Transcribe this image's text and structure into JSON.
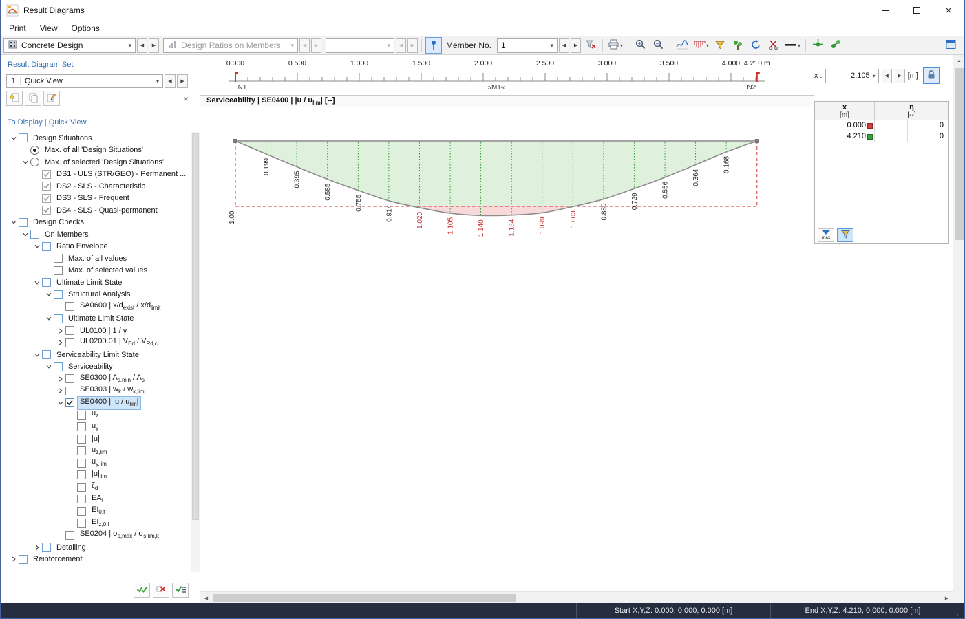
{
  "window": {
    "title": "Result Diagrams"
  },
  "menu": {
    "items": [
      {
        "label": "Print"
      },
      {
        "label": "View"
      },
      {
        "label": "Options"
      }
    ]
  },
  "toolbar": {
    "design_type": "Concrete Design",
    "result_type": "Design Ratios on Members",
    "extra_combo": "",
    "member_no_label": "Member No.",
    "member_no_value": "1",
    "icons": [
      "concrete-design-icon",
      "design-ratios-icon",
      "pin-icon",
      "funnel-x-icon",
      "printer-icon",
      "zoom-in-icon",
      "zoom-out-icon",
      "smooth-results-icon",
      "result-values-icon",
      "funnel-icon",
      "objects-icon",
      "refresh-icon",
      "trim-icon",
      "line-style-icon",
      "member-results-icon",
      "member-values-icon",
      "dock-panel-icon"
    ]
  },
  "left_panel": {
    "header": "Result Diagram Set",
    "set_number": "1",
    "set_name": "Quick View",
    "tree_header": "To Display | Quick View",
    "tree": [
      {
        "l": 0,
        "e": "down",
        "c": "cb",
        "s": "group",
        "t": "Design Situations"
      },
      {
        "l": 1,
        "e": null,
        "c": "radio",
        "s": "on",
        "t": "Max. of all 'Design Situations'"
      },
      {
        "l": 1,
        "e": "down",
        "c": "radio",
        "s": "off",
        "t": "Max. of selected 'Design Situations'"
      },
      {
        "l": 2,
        "e": null,
        "c": "cb",
        "s": "gray",
        "t": "DS1 - ULS (STR/GEO) - Permanent ..."
      },
      {
        "l": 2,
        "e": null,
        "c": "cb",
        "s": "gray",
        "t": "DS2 - SLS - Characteristic"
      },
      {
        "l": 2,
        "e": null,
        "c": "cb",
        "s": "gray",
        "t": "DS3 - SLS - Frequent"
      },
      {
        "l": 2,
        "e": null,
        "c": "cb",
        "s": "gray",
        "t": "DS4 - SLS - Quasi-permanent"
      },
      {
        "l": 0,
        "e": "down",
        "c": "cb",
        "s": "group",
        "t": "Design Checks"
      },
      {
        "l": 1,
        "e": "down",
        "c": "cb",
        "s": "group",
        "t": "On Members"
      },
      {
        "l": 2,
        "e": "down",
        "c": "cb",
        "s": "group",
        "t": "Ratio Envelope"
      },
      {
        "l": 3,
        "e": null,
        "c": "cb",
        "s": "off",
        "t": "Max. of all values"
      },
      {
        "l": 3,
        "e": null,
        "c": "cb",
        "s": "off",
        "t": "Max. of selected values"
      },
      {
        "l": 2,
        "e": "down",
        "c": "cb",
        "s": "group",
        "t": "Ultimate Limit State"
      },
      {
        "l": 3,
        "e": "down",
        "c": "cb",
        "s": "group",
        "t": "Structural Analysis"
      },
      {
        "l": 4,
        "e": null,
        "c": "cb",
        "s": "off",
        "t": "SA0600 | x/d<sub>exist</sub> / x/d<sub>limit</sub>"
      },
      {
        "l": 3,
        "e": "down",
        "c": "cb",
        "s": "group",
        "t": "Ultimate Limit State"
      },
      {
        "l": 4,
        "e": "right",
        "c": "cb",
        "s": "off",
        "t": "UL0100 | 1 / γ"
      },
      {
        "l": 4,
        "e": "right",
        "c": "cb",
        "s": "off",
        "t": "UL0200.01 | V<sub>Ed</sub> / V<sub>Rd,c</sub>"
      },
      {
        "l": 2,
        "e": "down",
        "c": "cb",
        "s": "group",
        "t": "Serviceability Limit State"
      },
      {
        "l": 3,
        "e": "down",
        "c": "cb",
        "s": "group",
        "t": "Serviceability"
      },
      {
        "l": 4,
        "e": "right",
        "c": "cb",
        "s": "off",
        "t": "SE0300 | A<sub>s,min</sub> / A<sub>s</sub>"
      },
      {
        "l": 4,
        "e": "right",
        "c": "cb",
        "s": "off",
        "t": "SE0303 | w<sub>k</sub> / w<sub>k,lim</sub>"
      },
      {
        "l": 4,
        "e": "down",
        "c": "cb",
        "s": "on",
        "sel": true,
        "t": "SE0400 | |u / u<sub>lim</sub>|"
      },
      {
        "l": 5,
        "e": null,
        "c": "cb",
        "s": "off",
        "t": "u<sub>z</sub>"
      },
      {
        "l": 5,
        "e": null,
        "c": "cb",
        "s": "off",
        "t": "u<sub>y</sub>"
      },
      {
        "l": 5,
        "e": null,
        "c": "cb",
        "s": "off",
        "t": "|u|"
      },
      {
        "l": 5,
        "e": null,
        "c": "cb",
        "s": "off",
        "t": "u<sub>z,lim</sub>"
      },
      {
        "l": 5,
        "e": null,
        "c": "cb",
        "s": "off",
        "t": "u<sub>y,lim</sub>"
      },
      {
        "l": 5,
        "e": null,
        "c": "cb",
        "s": "off",
        "t": "|u|<sub>lim</sub>"
      },
      {
        "l": 5,
        "e": null,
        "c": "cb",
        "s": "off",
        "t": "ζ<sub>d</sub>"
      },
      {
        "l": 5,
        "e": null,
        "c": "cb",
        "s": "off",
        "t": "EA<sub>f</sub>"
      },
      {
        "l": 5,
        "e": null,
        "c": "cb",
        "s": "off",
        "t": "EI<sub>0,f</sub>"
      },
      {
        "l": 5,
        "e": null,
        "c": "cb",
        "s": "off",
        "t": "EI<sub>z,0,f</sub>"
      },
      {
        "l": 4,
        "e": null,
        "c": "cb",
        "s": "off",
        "t": "SE0204 | σ<sub>s,max</sub> / σ<sub>s,lim,k</sub>"
      },
      {
        "l": 2,
        "e": "right",
        "c": "cb",
        "s": "group",
        "t": "Detailing"
      },
      {
        "l": 0,
        "e": "right",
        "c": "cb",
        "s": "group",
        "t": "Reinforcement"
      }
    ]
  },
  "diagram": {
    "x_label": "x :",
    "x_value": "2.105",
    "x_unit": "[m]",
    "subtitle_html": "Serviceability | SE0400 | |u / u<sub>lim</sub>| [--]",
    "node_start": "N1",
    "member_label": "»M1«",
    "node_end": "N2",
    "limit_label": "1.00"
  },
  "ruler": {
    "labels": [
      {
        "v": 0,
        "t": "0.000"
      },
      {
        "v": 0.5,
        "t": "0.500"
      },
      {
        "v": 1,
        "t": "1.000"
      },
      {
        "v": 1.5,
        "t": "1.500"
      },
      {
        "v": 2,
        "t": "2.000"
      },
      {
        "v": 2.5,
        "t": "2.500"
      },
      {
        "v": 3,
        "t": "3.000"
      },
      {
        "v": 3.5,
        "t": "3.500"
      },
      {
        "v": 4,
        "t": "4.000"
      },
      {
        "v": 4.21,
        "t": "4.210 m"
      }
    ],
    "minor_step": 0.1
  },
  "chart_data": {
    "type": "line",
    "title": "Serviceability | SE0400 | |u / u_lim| [--]",
    "xlabel": "x [m]",
    "ylabel": "η [--]",
    "x": [
      0,
      0.248,
      0.495,
      0.743,
      0.991,
      1.238,
      1.486,
      1.734,
      1.981,
      2.229,
      2.476,
      2.724,
      2.972,
      3.219,
      3.467,
      3.714,
      3.962,
      4.21
    ],
    "values": [
      0,
      0.199,
      0.395,
      0.585,
      0.755,
      0.914,
      1.02,
      1.105,
      1.14,
      1.134,
      1.099,
      1.003,
      0.889,
      0.729,
      0.556,
      0.364,
      0.168,
      0
    ],
    "limit": 1.0,
    "x_range": [
      0,
      4.21
    ],
    "legend": "values above limit 1.00 shown red"
  },
  "table": {
    "col_x": "x",
    "col_x_unit": "[m]",
    "col_eta": "η",
    "col_eta_unit": "[--]",
    "rows": [
      {
        "x": "0.000",
        "marker": "red",
        "eta": "0"
      },
      {
        "x": "4.210",
        "marker": "green",
        "eta": "0"
      }
    ],
    "buttons": [
      {
        "name": "extreme-values-button",
        "label": "max"
      },
      {
        "name": "filter-values-button",
        "label": ""
      }
    ]
  },
  "status": {
    "start": "Start X,Y,Z: 0.000, 0.000, 0.000 [m]",
    "end": "End X,Y,Z: 4.210, 0.000, 0.000 [m]"
  }
}
